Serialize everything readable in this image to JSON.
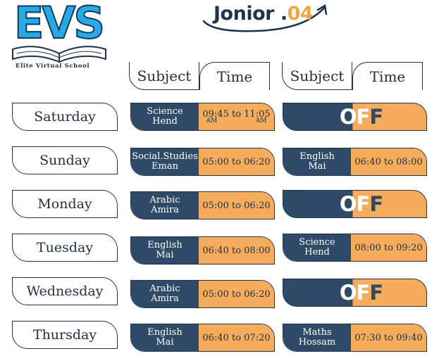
{
  "logo": {
    "text": "EVS",
    "subtitle": "Elite Virtual School"
  },
  "title": {
    "main": "Jonior .",
    "accent": "04"
  },
  "headers": {
    "subject": "Subject",
    "time": "Time"
  },
  "off_label": {
    "o": "O",
    "f1": "F",
    "f2": "F"
  },
  "colors": {
    "navy": "#2e4a66",
    "orange": "#f5ac5b",
    "logo_blue": "#29a9e1",
    "title_dark": "#1f3350"
  },
  "days": [
    {
      "name": "Saturday",
      "slot1": {
        "subject": "Science",
        "teacher": "Hend",
        "time": "09:45 to 11:05",
        "ampm_left": "AM",
        "ampm_right": "AM"
      },
      "slot2": {
        "off": true
      }
    },
    {
      "name": "Sunday",
      "slot1": {
        "subject": "Social.Studies",
        "teacher": "Eman",
        "time": "05:00 to 06:20"
      },
      "slot2": {
        "subject": "English",
        "teacher": "Mai",
        "time": "06:40 to 08:00"
      }
    },
    {
      "name": "Monday",
      "slot1": {
        "subject": "Arabic",
        "teacher": "Amira",
        "time": "05:00 to 06:20"
      },
      "slot2": {
        "off": true
      }
    },
    {
      "name": "Tuesday",
      "slot1": {
        "subject": "English",
        "teacher": "Mai",
        "time": "06:40 to 08:00"
      },
      "slot2": {
        "subject": "Science",
        "teacher": "Hend",
        "time": "08:00 to 09:20"
      }
    },
    {
      "name": "Wednesday",
      "slot1": {
        "subject": "Arabic",
        "teacher": "Amira",
        "time": "05:00 to 06:20"
      },
      "slot2": {
        "off": true
      }
    },
    {
      "name": "Thursday",
      "slot1": {
        "subject": "English",
        "teacher": "Mai",
        "time": "06:40 to 07:20"
      },
      "slot2": {
        "subject": "Maths",
        "teacher": "Hossam",
        "time": "07:30 to 09:40"
      }
    }
  ]
}
